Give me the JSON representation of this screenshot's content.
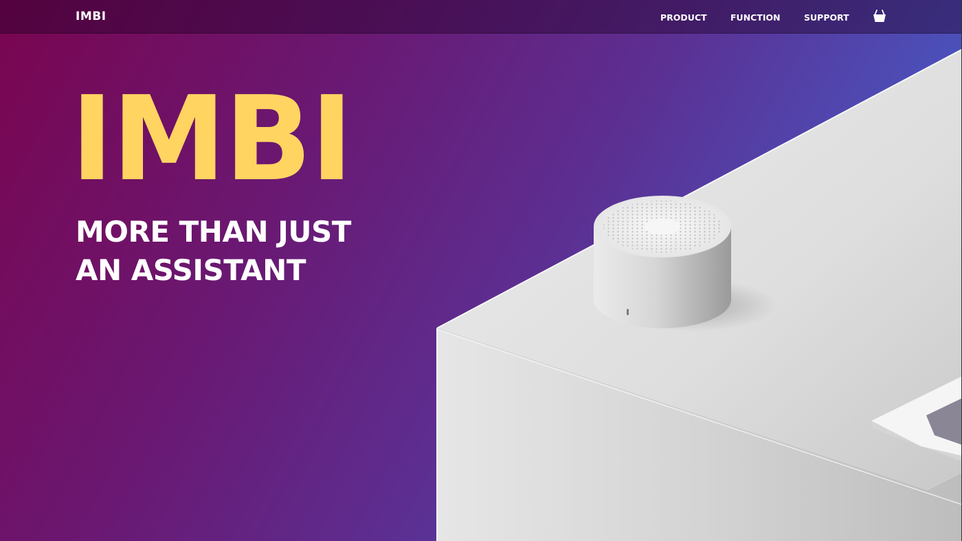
{
  "navbar": {
    "logo": "IMBI",
    "links": [
      "PRODUCT",
      "FUNCTION",
      "SUPPORT"
    ],
    "cart_icon": "shopping-basket-icon"
  },
  "hero": {
    "title": "IMBI",
    "tagline": [
      "MORE THAN JUST",
      "AN ASSISTANT"
    ],
    "title_color": "#ffd461",
    "background_gradient": [
      "#7a0550",
      "#5c2f92",
      "#4656c4"
    ]
  }
}
